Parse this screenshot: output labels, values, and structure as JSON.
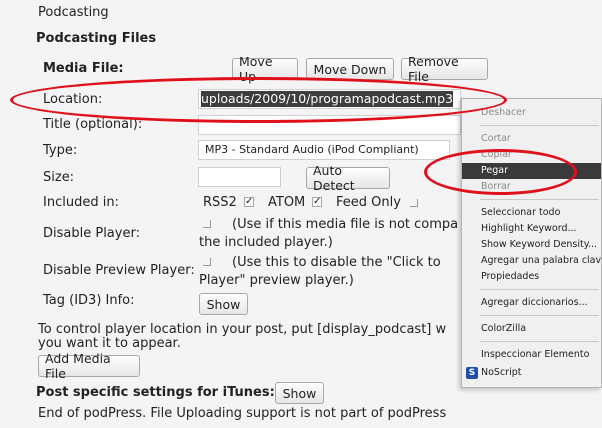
{
  "section_header": "Podcasting",
  "files_header": "Podcasting Files",
  "media_file_label": "Media File:",
  "buttons": {
    "move_up": "Move Up",
    "move_down": "Move Down",
    "remove_file": "Remove File",
    "auto_detect": "Auto Detect",
    "show_tag": "Show",
    "add_media": "Add Media File",
    "show_itunes": "Show"
  },
  "fields": {
    "location_label": "Location:",
    "location_value": "uploads/2009/10/programapodcast.mp3",
    "title_label": "Title (optional):",
    "type_label": "Type:",
    "type_value": "MP3 - Standard Audio (iPod Compliant)",
    "size_label": "Size:",
    "included_label": "Included in:",
    "rss2": "RSS2",
    "atom": "ATOM",
    "feed_only": "Feed Only",
    "disable_player_label": "Disable Player:",
    "disable_player_text1": "(Use if this media file is not compa",
    "disable_player_text2": "the included player.)",
    "disable_preview_label": "Disable Preview Player:",
    "disable_preview_text1": "(Use this to disable the \"Click to",
    "disable_preview_text2": "Player\" preview player.)",
    "tag_label": "Tag (ID3) Info:"
  },
  "notes": {
    "control_line1": "To control player location in your post, put [display_podcast] w",
    "control_line2": "you want it to appear.",
    "itunes_label": "Post specific settings for iTunes:",
    "footer": "End of podPress. File Uploading support is not part of podPress"
  },
  "context_menu": {
    "items": [
      {
        "label": "Deshacer",
        "state": "enabled"
      },
      {
        "label": "Cortar",
        "state": "enabled"
      },
      {
        "label": "Copiar",
        "state": "enabled"
      },
      {
        "label": "Pegar",
        "state": "selected"
      },
      {
        "label": "Borrar",
        "state": "enabled"
      },
      {
        "label": "Seleccionar todo",
        "state": "enabled"
      },
      {
        "label": "Highlight Keyword...",
        "state": "enabled"
      },
      {
        "label": "Show Keyword Density...",
        "state": "enabled"
      },
      {
        "label": "Agregar una palabra clave",
        "state": "enabled"
      },
      {
        "label": "Propiedades",
        "state": "enabled"
      },
      {
        "label": "Agregar diccionarios...",
        "state": "enabled"
      },
      {
        "label": "ColorZilla",
        "state": "enabled"
      },
      {
        "label": "Inspeccionar Elemento",
        "state": "enabled"
      },
      {
        "label": "NoScript",
        "state": "enabled"
      }
    ]
  },
  "colors": {
    "annotation": "#e0101a",
    "selection": "#3a3a3a",
    "text_selection": "#3d3d3d"
  },
  "icons": {
    "checked": "✓",
    "noscript": "noscript-icon"
  }
}
